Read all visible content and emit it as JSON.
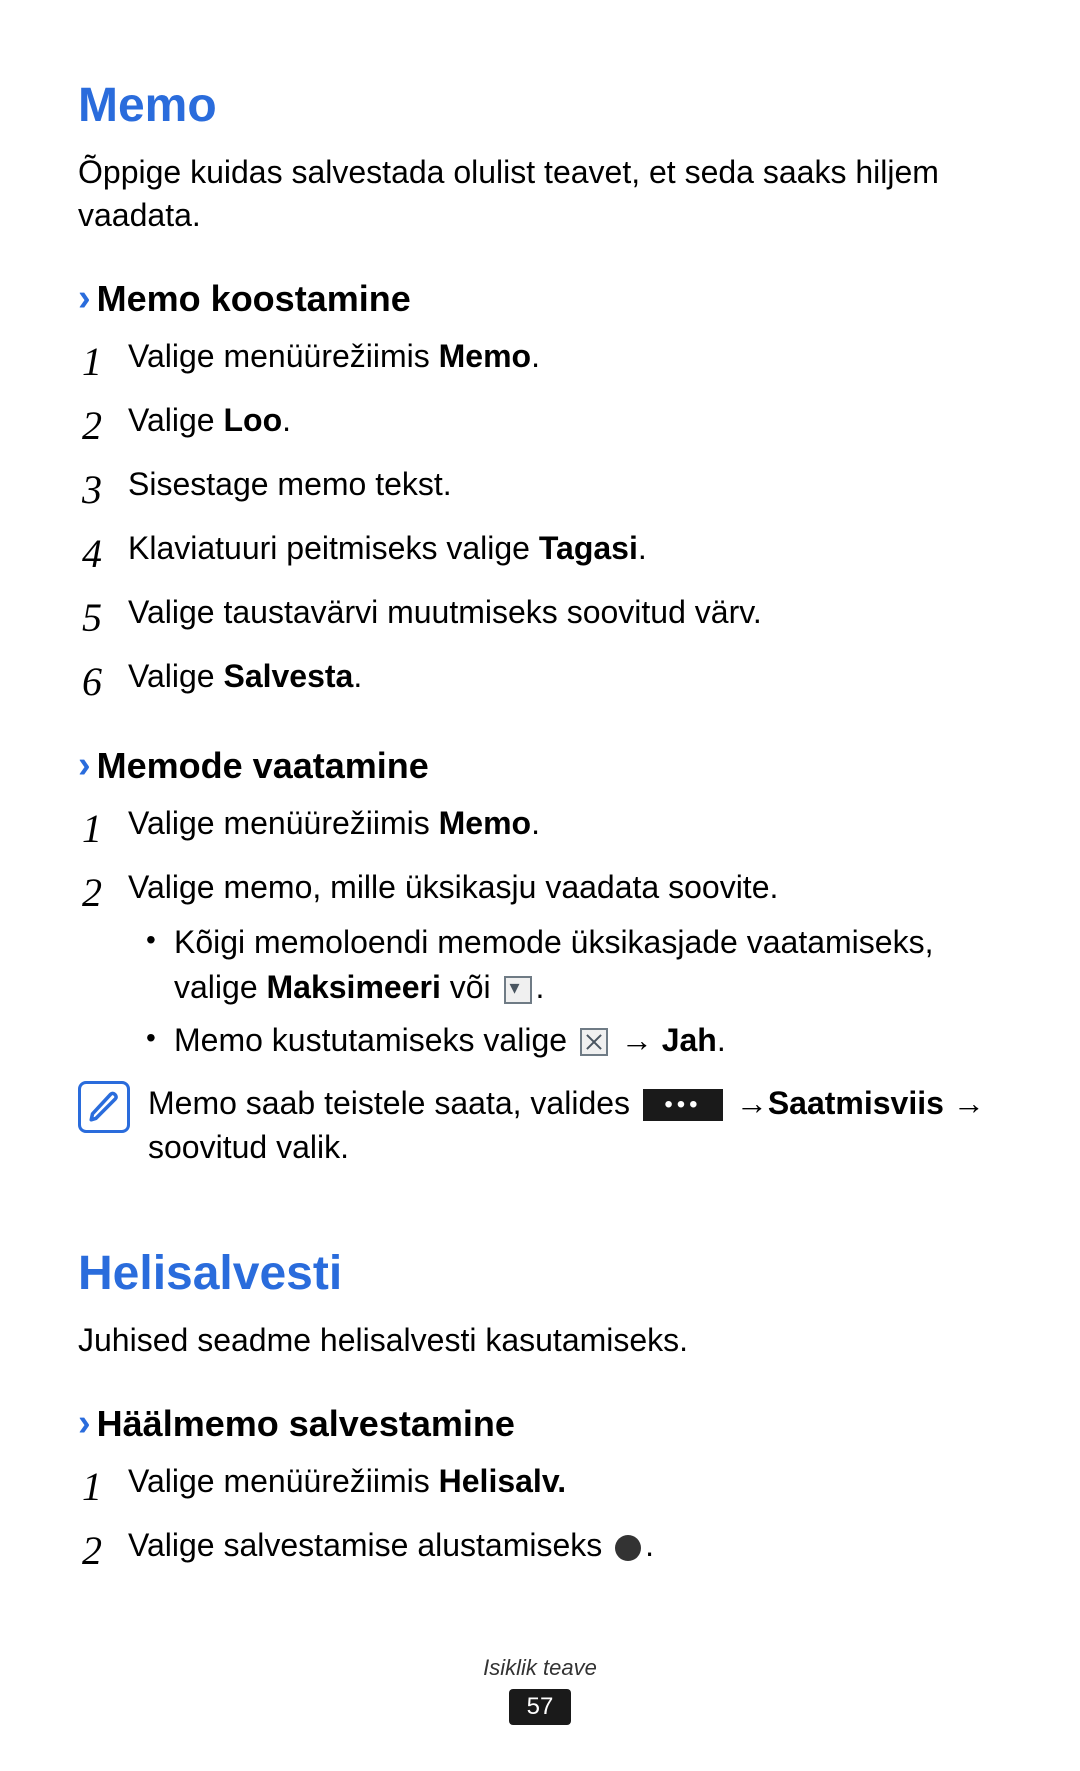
{
  "memo": {
    "title": "Memo",
    "intro": "Õppige kuidas salvestada olulist teavet, et seda saaks hiljem vaadata.",
    "create": {
      "heading": "Memo koostamine",
      "steps": {
        "s1_a": "Valige menüürežiimis ",
        "s1_b": "Memo",
        "s1_c": ".",
        "s2_a": "Valige ",
        "s2_b": "Loo",
        "s2_c": ".",
        "s3": "Sisestage memo tekst.",
        "s4_a": "Klaviatuuri peitmiseks valige ",
        "s4_b": "Tagasi",
        "s4_c": ".",
        "s5": "Valige taustavärvi muutmiseks soovitud värv.",
        "s6_a": "Valige ",
        "s6_b": "Salvesta",
        "s6_c": "."
      }
    },
    "view": {
      "heading": "Memode vaatamine",
      "steps": {
        "s1_a": "Valige menüürežiimis ",
        "s1_b": "Memo",
        "s1_c": ".",
        "s2": "Valige memo, mille üksikasju vaadata soovite.",
        "b1_a": "Kõigi memoloendi memode üksikasjade vaatamiseks, valige ",
        "b1_b": "Maksimeeri",
        "b1_c": " või ",
        "b1_d": ".",
        "b2_a": "Memo kustutamiseks valige ",
        "b2_b": " → ",
        "b2_c": "Jah",
        "b2_d": "."
      },
      "note": {
        "a": "Memo saab teistele saata, valides ",
        "b": " →",
        "c": "Saatmisviis",
        "d": " → soovitud valik."
      }
    }
  },
  "recorder": {
    "title": "Helisalvesti",
    "intro": "Juhised seadme helisalvesti kasutamiseks.",
    "record": {
      "heading": "Häälmemo salvestamine",
      "steps": {
        "s1_a": "Valige menüürežiimis ",
        "s1_b": "Helisalv.",
        "s2_a": "Valige salvestamise alustamiseks ",
        "s2_b": "."
      }
    }
  },
  "footer": {
    "label": "Isiklik teave",
    "page": "57"
  },
  "nums": {
    "n1": "1",
    "n2": "2",
    "n3": "3",
    "n4": "4",
    "n5": "5",
    "n6": "6"
  }
}
